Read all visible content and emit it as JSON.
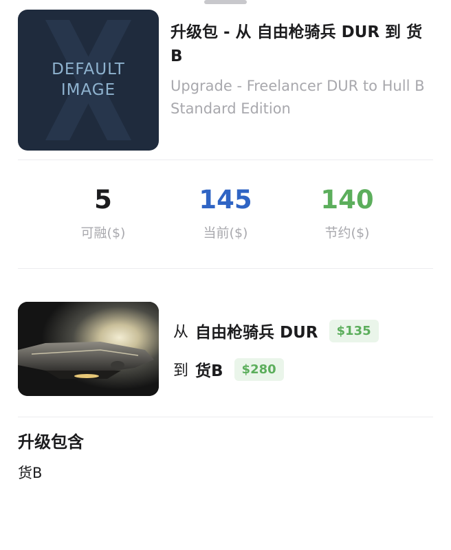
{
  "product": {
    "thumbnail_line1": "DEFAULT",
    "thumbnail_line2": "IMAGE",
    "thumbnail_watermark": "X",
    "title": "升级包 - 从 自由枪骑兵 DUR 到 货B",
    "subtitle": "Upgrade - Freelancer DUR to Hull B Standard Edition"
  },
  "stats": [
    {
      "value": "5",
      "label": "可融($)",
      "color": "#1c1c1e"
    },
    {
      "value": "145",
      "label": "当前($)",
      "color": "#2f64c4"
    },
    {
      "value": "140",
      "label": "节约($)",
      "color": "#5cae5c"
    }
  ],
  "upgrade": {
    "from_prefix": "从",
    "from_ship": "自由枪骑兵 DUR",
    "from_price": "$135",
    "to_prefix": "到",
    "to_ship": "货B",
    "to_price": "$280"
  },
  "includes": {
    "title": "升级包含",
    "items": [
      "货B"
    ]
  },
  "colors": {
    "accent_blue": "#2f64c4",
    "accent_green": "#5cae5c",
    "badge_bg": "#eaf5ea",
    "muted_text": "#a8a8ad"
  }
}
